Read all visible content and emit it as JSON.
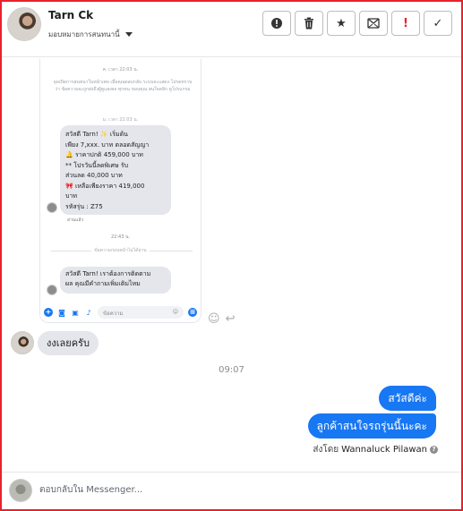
{
  "header": {
    "name": "Tarn Ck",
    "subtitle": "มอบหมายการสนทนานี้",
    "actions": [
      {
        "icon": "exclamation-circle-icon",
        "glyph": "❗"
      },
      {
        "icon": "trash-icon",
        "glyph": "🗑"
      },
      {
        "icon": "star-icon",
        "glyph": "★"
      },
      {
        "icon": "envelope-icon",
        "glyph": "✉"
      },
      {
        "icon": "important-icon",
        "glyph": "!"
      },
      {
        "icon": "checkmark-icon",
        "glyph": "✓"
      }
    ]
  },
  "screenshot": {
    "time1": "ค. เวลา 22:03 น.",
    "notice": "จุดเปิดการสนทนาในหน้าเพจ เมื่อคุณตอบกลับ ระบบจะแสดง โปรดทราบว่า ข้อความจะถูกส่งถึงผู้ดูแลเพจ ทุกคน ขอบคุณ สนใจคลิก ดูโปรแกรม",
    "time2": "ม. เวลา 22:03 น.",
    "bubble_lines": [
      "สวัสดี Tarn! ✨ เริ่มต้น",
      "เพียง 7,xxx. บาท ตลอดสัญญา",
      "🔔 ราคาปกติ 459,000 บาท",
      "** โปรวันนี้ลดพิเศษ รับ",
      "ส่วนลด 40,000 บาท",
      "🎀 เหลือเพียงราคา 419,000",
      "บาท",
      "รหัสรุ่น : Z75"
    ],
    "seen": "อ่านแล้ว",
    "time3": "22:43 น.",
    "divider_text": "ข้อความก่อนหน้าไม่ได้อ่าน",
    "bubble2_lines": [
      "สวัสดี Tarn! เราต้องการติดตาม",
      "ผล คุณมีคำถามเพิ่มเติมไหม"
    ],
    "input_placeholder": "ข้อความ"
  },
  "reactions": {
    "smile": "☺",
    "reply": "↩"
  },
  "messages": {
    "incoming": "งงเลยครับ",
    "timestamp": "09:07",
    "outgoing": [
      "สวัสดีค่ะ",
      "ลูกค้าสนใจรถรุ่นนี้นะคะ"
    ],
    "sent_by_label": "ส่งโดย",
    "sent_by_name": "Wannaluck Pilawan"
  },
  "composer": {
    "placeholder": "ตอบกลับใน Messenger..."
  }
}
